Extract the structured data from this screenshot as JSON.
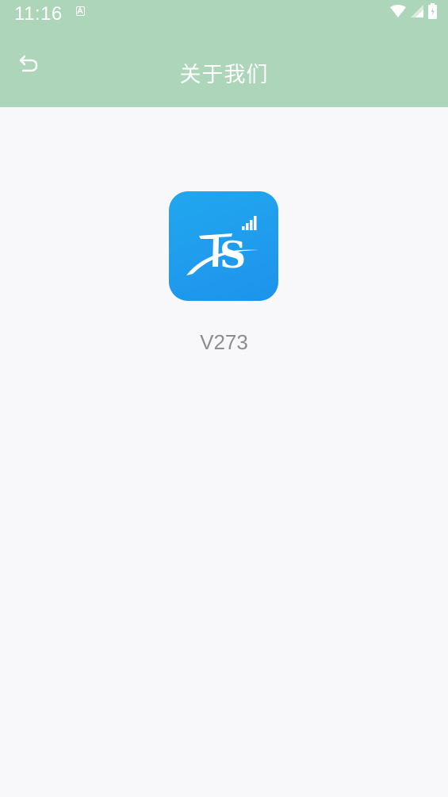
{
  "status_bar": {
    "time": "11:16",
    "icons": [
      "keyboard-a-icon",
      "wifi-icon",
      "cell-signal-icon",
      "battery-icon"
    ]
  },
  "app_bar": {
    "title": "关于我们",
    "back_icon": "back-arrow-icon",
    "background_color": "#acd5b9"
  },
  "about": {
    "logo_text": "TS",
    "version": "V273"
  },
  "colors": {
    "page_background": "#f8f8fb",
    "logo_blue": "#1d9bec",
    "version_gray": "#8c8c93"
  }
}
